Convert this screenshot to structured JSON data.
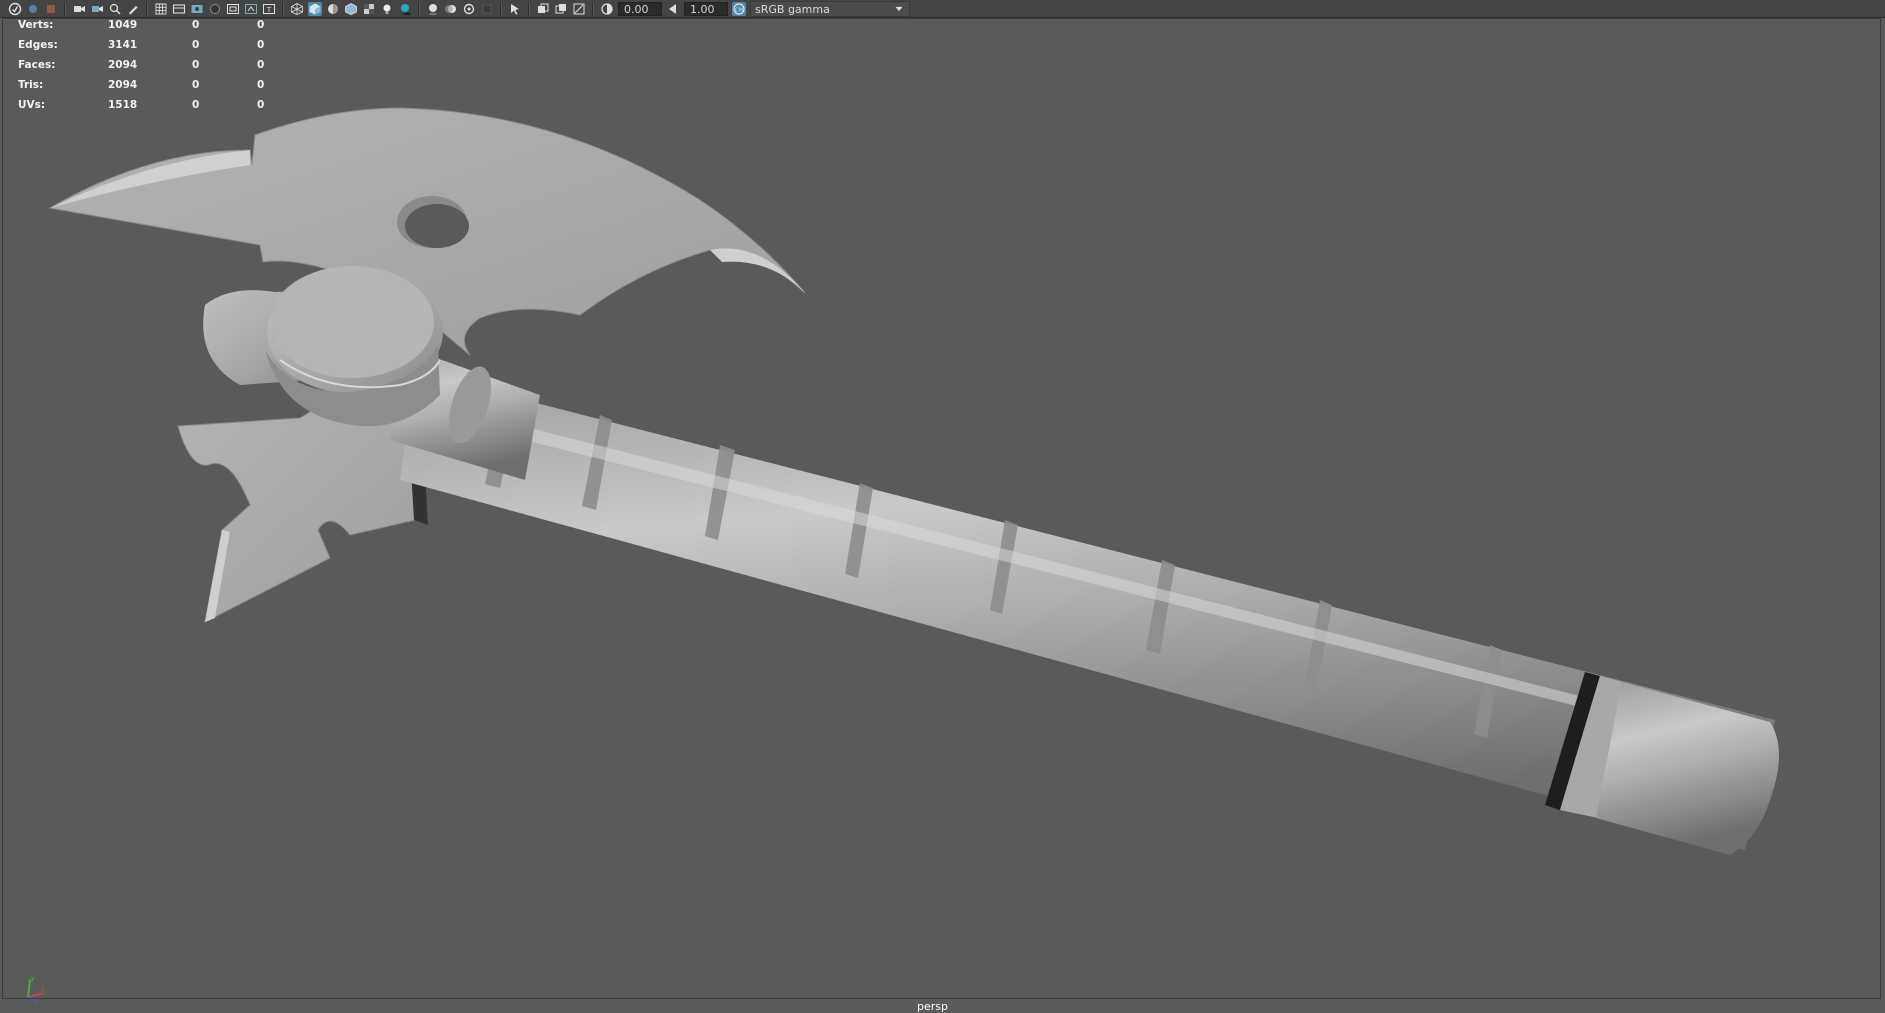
{
  "toolbar": {
    "exposure_value": "0.00",
    "gamma_value": "1.00",
    "color_space": "sRGB gamma",
    "icons": [
      "select-camera-icon",
      "camera-attributes-icon",
      "bookmarks-icon",
      "image-plane-icon",
      "camera-icon",
      "2d-pan-zoom-icon",
      "grease-pencil-icon",
      "grid-icon",
      "film-gate-icon",
      "resolution-gate-icon",
      "gate-mask-icon",
      "field-chart-icon",
      "safe-action-icon",
      "safe-title-icon",
      "wireframe-icon",
      "smooth-shade-icon",
      "default-material-icon",
      "wireframe-on-shaded-icon",
      "textured-icon",
      "use-lights-icon",
      "shadows-icon",
      "screen-space-ao-icon",
      "motion-blur-icon",
      "anti-alias-icon",
      "depth-of-field-icon",
      "isolate-select-icon",
      "xray-icon",
      "xray-active-components-icon",
      "xray-joints-icon",
      "exposure-icon",
      "gamma-icon",
      "color-management-icon"
    ]
  },
  "hud": {
    "rows": [
      {
        "label": "Verts:",
        "v1": "1049",
        "v2": "0",
        "v3": "0"
      },
      {
        "label": "Edges:",
        "v1": "3141",
        "v2": "0",
        "v3": "0"
      },
      {
        "label": "Faces:",
        "v1": "2094",
        "v2": "0",
        "v3": "0"
      },
      {
        "label": "Tris:",
        "v1": "2094",
        "v2": "0",
        "v3": "0"
      },
      {
        "label": "UVs:",
        "v1": "1518",
        "v2": "0",
        "v3": "0"
      }
    ]
  },
  "viewport": {
    "camera_label": "persp",
    "background_color": "#5a5a5a",
    "model_color": "#a9a9a9",
    "axis_colors": {
      "x": "#e04040",
      "y": "#40c040",
      "z": "#4060e0"
    }
  },
  "colors": {
    "toolbar_bg": "#444444",
    "active_icon": "#5285a6",
    "hud_text": "#f2f2f2"
  }
}
